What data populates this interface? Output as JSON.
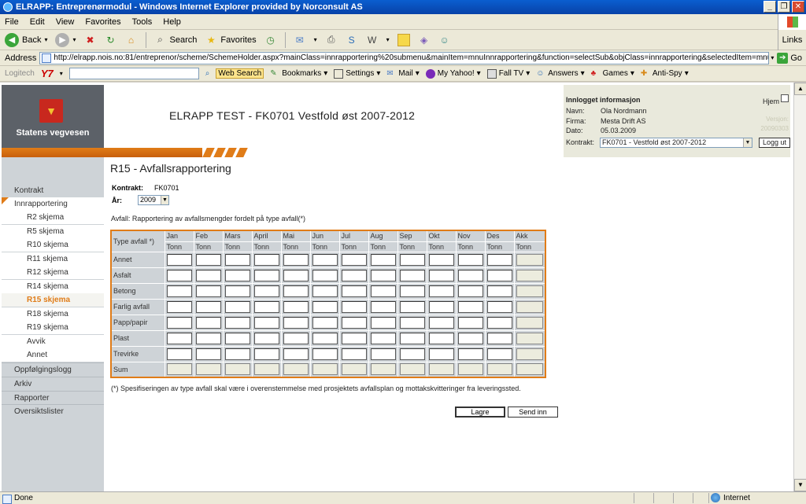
{
  "window": {
    "title": "ELRAPP: Entreprenørmodul - Windows Internet Explorer provided by Norconsult AS",
    "buttons": [
      "_",
      "❐",
      "✕"
    ]
  },
  "menu": [
    "File",
    "Edit",
    "View",
    "Favorites",
    "Tools",
    "Help"
  ],
  "toolbar": {
    "back_label": "Back",
    "search_label": "Search",
    "favorites_label": "Favorites",
    "links_label": "Links"
  },
  "address": {
    "label": "Address",
    "url": "http://elrapp.nois.no:81/entreprenor/scheme/SchemeHolder.aspx?mainClass=innrapportering%20submenu&mainItem=mnuInnrapportering&function=selectSub&objClass=innrapportering&selectedItem=mnuInnrapportering12&scheme_file_na",
    "go_label": "Go"
  },
  "yahoo_toolbar": {
    "logitech": "Logitech",
    "y7": "Y7",
    "web_search": "Web Search",
    "items": [
      "Bookmarks",
      "Settings",
      "Mail",
      "My Yahoo!",
      "Fall TV",
      "Answers",
      "Games",
      "Anti-Spy"
    ]
  },
  "site": {
    "logo_text": "Statens vegvesen",
    "title": "ELRAPP TEST - FK0701 Vestfold øst 2007-2012"
  },
  "login": {
    "header": "Innlogget informasjon",
    "hjem": "Hjem",
    "navn_label": "Navn:",
    "navn": "Ola Nordmann",
    "firma_label": "Firma:",
    "firma": "Mesta Drift AS",
    "dato_label": "Dato:",
    "dato": "05.03.2009",
    "versjon_label": "Versjon:",
    "versjon": "20090303",
    "kontrakt_label": "Kontrakt:",
    "kontrakt_value": "FK0701 - Vestfold øst 2007-2012",
    "logg_ut": "Logg ut"
  },
  "sidebar": {
    "items": [
      {
        "label": "Kontrakt",
        "kind": "top"
      },
      {
        "label": "Innrapportering",
        "kind": "parent"
      },
      {
        "label": "R2 skjema",
        "kind": "sub"
      },
      {
        "label": "R5 skjema",
        "kind": "sub"
      },
      {
        "label": "R10 skjema",
        "kind": "sub"
      },
      {
        "label": "R11 skjema",
        "kind": "sub"
      },
      {
        "label": "R12 skjema",
        "kind": "sub"
      },
      {
        "label": "R14 skjema",
        "kind": "sub"
      },
      {
        "label": "R15 skjema",
        "kind": "active"
      },
      {
        "label": "R18 skjema",
        "kind": "sub"
      },
      {
        "label": "R19 skjema",
        "kind": "sub"
      },
      {
        "label": "Avvik",
        "kind": "sub"
      },
      {
        "label": "Annet",
        "kind": "sub"
      },
      {
        "label": "Oppfølgingslogg",
        "kind": "top"
      },
      {
        "label": "Arkiv",
        "kind": "top"
      },
      {
        "label": "Rapporter",
        "kind": "top"
      },
      {
        "label": "Oversiktslister",
        "kind": "top"
      }
    ]
  },
  "form": {
    "title": "R15 - Avfallsrapportering",
    "kontrakt_label": "Kontrakt:",
    "kontrakt_value": "FK0701",
    "aar_label": "År:",
    "aar_value": "2009",
    "description": "Avfall: Rapportering av avfallsmengder fordelt på type avfall(*)",
    "type_header": "Type avfall *)",
    "months": [
      "Jan",
      "Feb",
      "Mars",
      "April",
      "Mai",
      "Jun",
      "Jul",
      "Aug",
      "Sep",
      "Okt",
      "Nov",
      "Des",
      "Akk"
    ],
    "unit": "Tonn",
    "rows": [
      "Annet",
      "Asfalt",
      "Betong",
      "Farlig avfall",
      "Papp/papir",
      "Plast",
      "Trevirke",
      "Sum"
    ],
    "footnote": "(*) Spesifiseringen av type avfall skal være i overenstemmelse med prosjektets avfallsplan og mottakskvitteringer fra leveringssted.",
    "save_label": "Lagre",
    "send_label": "Send inn"
  },
  "status": {
    "text": "Done",
    "zone": "Internet"
  }
}
